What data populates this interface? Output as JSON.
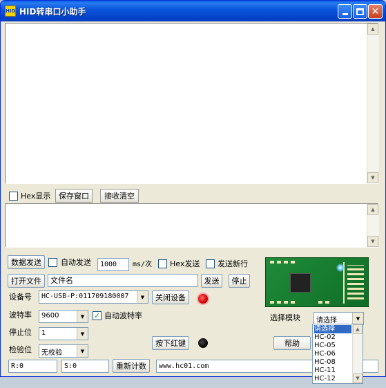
{
  "window": {
    "title": "HID转串口小助手",
    "icon_text": "HID"
  },
  "receive_toolbar": {
    "hex_display_label": "Hex显示",
    "save_window_label": "保存窗口",
    "clear_receive_label": "接收清空"
  },
  "send": {
    "send_data_label": "数据发送",
    "auto_send_label": "自动发送",
    "interval_value": "1000",
    "interval_unit": "ms/次",
    "hex_send_label": "Hex发送",
    "send_newline_label": "发送新行",
    "open_file_label": "打开文件",
    "filename_value": "文件名",
    "send_label": "发送",
    "stop_label": "停止"
  },
  "device": {
    "device_label": "设备号",
    "device_value": "HC-USB-P:011709180007",
    "close_device_label": "关闭设备",
    "baud_label": "波特率",
    "baud_value": "9600",
    "auto_baud_label": "自动波特率",
    "stop_bits_label": "停止位",
    "stop_bits_value": "1",
    "parity_label": "检验位",
    "parity_value": "无校验",
    "press_red_key_label": "按下红键"
  },
  "module": {
    "select_label": "选择模块",
    "select_value": "请选择",
    "help_label": "帮助",
    "options": [
      "请选择",
      "HC-02",
      "HC-05",
      "HC-06",
      "HC-08",
      "HC-11",
      "HC-12"
    ]
  },
  "status": {
    "rx_value": "R:0",
    "tx_value": "S:0",
    "recount_label": "重新计数",
    "website_value": "www.hc01.com"
  },
  "colors": {
    "titlebar": "#0b57dc",
    "window_bg": "#ece9d8",
    "selection": "#316ac5",
    "led_red": "#d00000"
  }
}
